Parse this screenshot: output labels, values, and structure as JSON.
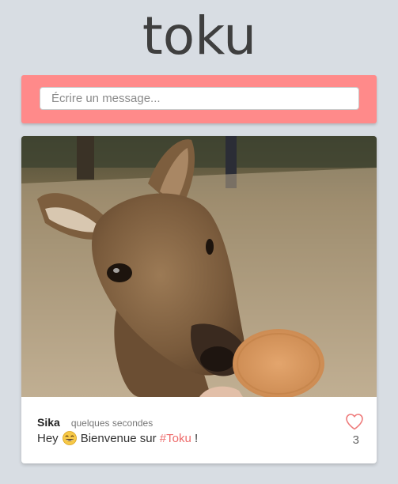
{
  "app": {
    "logo_text": "toku"
  },
  "composer": {
    "placeholder": "Écrire un message..."
  },
  "post": {
    "author": "Sika",
    "time": "quelques secondes",
    "message_prefix": "Hey",
    "message_middle": "Bienvenue sur",
    "hashtag": "#Toku",
    "message_suffix": "!",
    "likes": "3",
    "emoji": "grinning-face",
    "image_subject": "deer"
  },
  "colors": {
    "background": "#d8dde3",
    "accent": "#ff8a8a",
    "hashtag": "#ee6b6b",
    "logo": "#3f3f3f"
  }
}
